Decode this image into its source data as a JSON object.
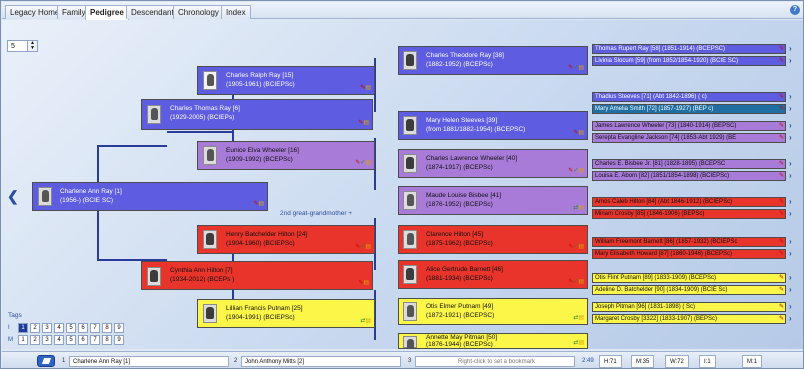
{
  "tabs": [
    {
      "label": "Legacy Home",
      "active": false
    },
    {
      "label": "Family",
      "active": false
    },
    {
      "label": "Pedigree",
      "active": true
    },
    {
      "label": "Descendant",
      "active": false
    },
    {
      "label": "Chronology",
      "active": false
    },
    {
      "label": "Index",
      "active": false
    }
  ],
  "generations_spinner": "5",
  "relation_label": "2nd great-grandmother +",
  "people": {
    "root": {
      "name": "Charlene Ann Ray [1]",
      "dates": "(1956-) (BCIE SC)"
    },
    "father": {
      "name": "Charles Thomas Ray [6]",
      "dates": "(1929-2005) (BCIEPs)"
    },
    "mother": {
      "name": "Cynthia Ann Hilton [7]",
      "dates": "(1934-2012) (BCEPs )"
    },
    "ff": {
      "name": "Charles Ralph Ray [15]",
      "dates": "(1905-1961) (BCIEPSc)"
    },
    "fm": {
      "name": "Eunice Elva Wheeler [16]",
      "dates": "(1909-1992) (BCEPSc)"
    },
    "mf": {
      "name": "Henry Batchelder Hilton [24]",
      "dates": "(1904-1960) (BCIEPSc)"
    },
    "mm": {
      "name": "Lillian Francis Putnam [25]",
      "dates": "(1904-1991) (BCIEPSc)"
    },
    "fff": {
      "name": "Charles Theodore Ray [38]",
      "dates": "(1882-1952) (BCEPSc)"
    },
    "ffm": {
      "name": "Mary Helen Steeves [39]",
      "dates": "(from 1881/1882-1954) (BCEPSC)"
    },
    "fmf": {
      "name": "Charles Lawrence Wheeler [40]",
      "dates": "(1874-1917) (BCEPSc)"
    },
    "fmm": {
      "name": "Maude Louise Bisbee [41]",
      "dates": "(1876-1952) (BCEPSc)"
    },
    "mff": {
      "name": "Clarence Hilton [45]",
      "dates": "(1875-1962) (BCEPSc)"
    },
    "mfm": {
      "name": "Alice Gertrude Barnett [46]",
      "dates": "(1881-1934) (BCEPSc)"
    },
    "mmf": {
      "name": "Otis Elmer Putnam [49]",
      "dates": "(1872-1921) (BCEPSC)"
    },
    "mmm": {
      "name": "Annette May Pitman [50]",
      "dates": "(1876-1944) (BCEPSc)"
    }
  },
  "ancestors": [
    {
      "text": "Thomas Rupert Ray [58] (1851-1914) (BCEPSC)",
      "color": "blue"
    },
    {
      "text": "Livinia Slocum [59] (from 1852/1854-1920) (BCIE SC)",
      "color": "blue"
    },
    {
      "text": "Thadius Steeves [71] (Abt 1842-1896) ( c)",
      "color": "blue"
    },
    {
      "text": "Mary Amelia Smith [72] (1857-1927) (BEP c)",
      "color": "teal"
    },
    {
      "text": "James Lawrence Wheeler [73] (1840-1914) (BEPSC)",
      "color": "purple"
    },
    {
      "text": "Serepta Evangline Jackson [74] (1853-Abt 1929) (BE",
      "color": "purple"
    },
    {
      "text": "Charles E. Bisbee Jr. [81] (1828-1895) (BCEPSC",
      "color": "purple"
    },
    {
      "text": "Louisa E. Aborn [82] (1851/1854-1898) (BCIEPSc)",
      "color": "purple"
    },
    {
      "text": "Amos Caleb Hilton [84] (Abt 1846-1912) (BCIEPSc)",
      "color": "red"
    },
    {
      "text": "Miriam Crosby [85] (1846-1906) (BEPSc)",
      "color": "red"
    },
    {
      "text": "William Freemont Barnett [86] (1857-1932) (BCIEPSc",
      "color": "red"
    },
    {
      "text": "Mary Elisabeth Howard [87] (1860-1946) (BCEPSc)",
      "color": "red"
    },
    {
      "text": "Otis Flint Putnam [89] (1833-1909) (BCEPSc)",
      "color": "yellow"
    },
    {
      "text": "Adeline D. Batchelder [90] (1834-1909) (BCIE Sc)",
      "color": "yellow"
    },
    {
      "text": "Joseph Pitman [96] (1831-1898) ( Sc)",
      "color": "yellow"
    },
    {
      "text": "Margaret Crosby [3322] (1833-1907) (BEPSc)",
      "color": "yellow"
    }
  ],
  "tags": {
    "label": "Tags",
    "rows": [
      {
        "label": "I",
        "cells": [
          "1",
          "2",
          "3",
          "4",
          "5",
          "6",
          "7",
          "8",
          "9"
        ],
        "selected": "1"
      },
      {
        "label": "M",
        "cells": [
          "1",
          "2",
          "3",
          "4",
          "5",
          "6",
          "7",
          "8",
          "9"
        ],
        "selected": ""
      }
    ]
  },
  "statusbar": {
    "field1_num": "1",
    "field1": "Charlene Ann Ray [1]",
    "field2_num": "2",
    "field2": "John Anthony Mitts [2]",
    "field3_num": "3",
    "bookmark_hint": "Right-click to set a bookmark",
    "time": "2:49",
    "h": "H:71",
    "m": "M:35",
    "w": "W:72",
    "i": "I:1",
    "mi": "M:1"
  },
  "colors": {
    "blue": "#5e5ce0",
    "purple": "#a87bd9",
    "red": "#e9342b",
    "yellow": "#fcf648",
    "teal": "#1f6fa3"
  }
}
